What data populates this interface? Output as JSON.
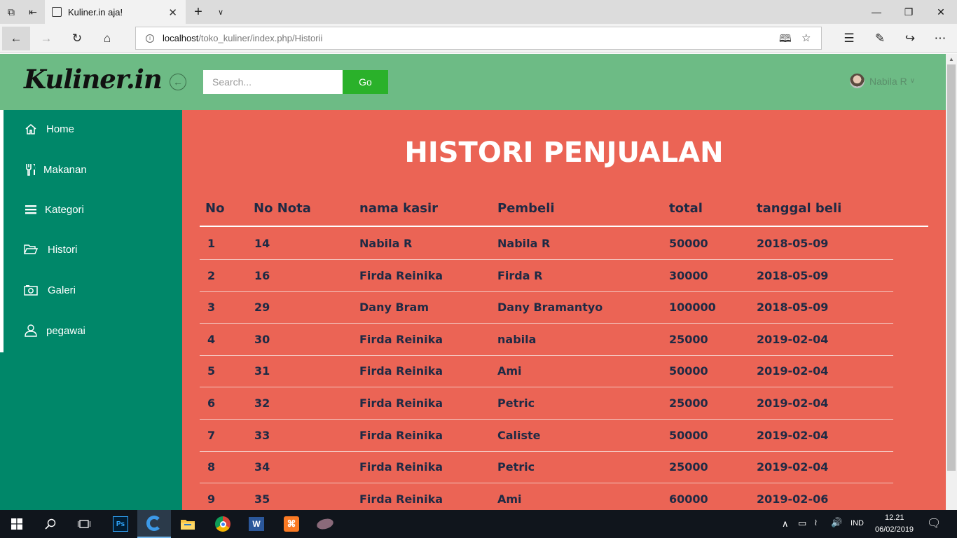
{
  "browser": {
    "tab_title": "Kuliner.in aja!",
    "url_host": "localhost",
    "url_path": "/toko_kuliner/index.php/Historii"
  },
  "header": {
    "logo": "Kuliner.in",
    "search_placeholder": "Search...",
    "go_label": "Go",
    "user_name": "Nabila R"
  },
  "sidebar": {
    "items": [
      {
        "label": "Home",
        "icon": "home-icon"
      },
      {
        "label": "Makanan",
        "icon": "cutlery-icon"
      },
      {
        "label": "Kategori",
        "icon": "list-icon"
      },
      {
        "label": "Histori",
        "icon": "folder-open-icon"
      },
      {
        "label": "Galeri",
        "icon": "camera-icon"
      },
      {
        "label": "pegawai",
        "icon": "user-icon"
      }
    ]
  },
  "main": {
    "title": "HISTORI PENJUALAN",
    "columns": [
      "No",
      "No Nota",
      "nama kasir",
      "Pembeli",
      "total",
      "tanggal beli"
    ],
    "rows": [
      [
        "1",
        "14",
        "Nabila R",
        "Nabila R",
        "50000",
        "2018-05-09"
      ],
      [
        "2",
        "16",
        "Firda Reinika",
        "Firda R",
        "30000",
        "2018-05-09"
      ],
      [
        "3",
        "29",
        "Dany Bram",
        "Dany Bramantyo",
        "100000",
        "2018-05-09"
      ],
      [
        "4",
        "30",
        "Firda Reinika",
        "nabila",
        "25000",
        "2019-02-04"
      ],
      [
        "5",
        "31",
        "Firda Reinika",
        "Ami",
        "50000",
        "2019-02-04"
      ],
      [
        "6",
        "32",
        "Firda Reinika",
        "Petric",
        "25000",
        "2019-02-04"
      ],
      [
        "7",
        "33",
        "Firda Reinika",
        "Caliste",
        "50000",
        "2019-02-04"
      ],
      [
        "8",
        "34",
        "Firda Reinika",
        "Petric",
        "25000",
        "2019-02-04"
      ],
      [
        "9",
        "35",
        "Firda Reinika",
        "Ami",
        "60000",
        "2019-02-06"
      ]
    ]
  },
  "taskbar": {
    "language": "IND",
    "time": "12.21",
    "date": "06/02/2019"
  },
  "colors": {
    "header_bg": "#6dbb85",
    "sidebar_bg": "#008769",
    "main_bg": "#eb6455",
    "go_button": "#2ab12a"
  }
}
